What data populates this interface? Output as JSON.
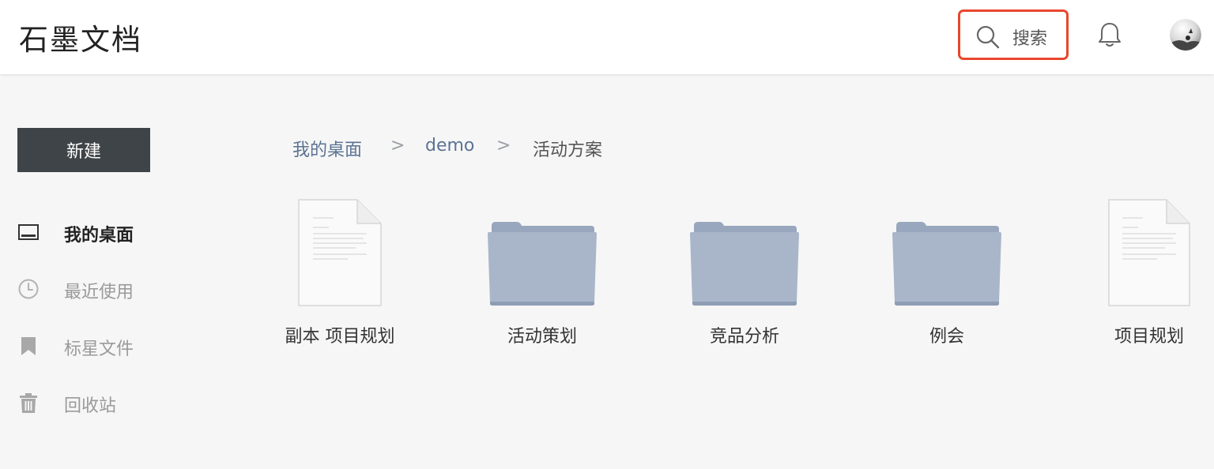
{
  "app": {
    "logo_text": "石墨文档"
  },
  "header": {
    "search_label": "搜索"
  },
  "sidebar": {
    "new_button": "新建",
    "items": [
      {
        "label": "我的桌面",
        "icon": "desktop-icon",
        "active": true
      },
      {
        "label": "最近使用",
        "icon": "clock-icon",
        "active": false
      },
      {
        "label": "标星文件",
        "icon": "bookmark-icon",
        "active": false
      },
      {
        "label": "回收站",
        "icon": "trash-icon",
        "active": false
      }
    ]
  },
  "breadcrumb": {
    "items": [
      "我的桌面",
      "demo",
      "活动方案"
    ],
    "separator": ">"
  },
  "files": [
    {
      "name": "副本 项目规划",
      "type": "document"
    },
    {
      "name": "活动策划",
      "type": "folder"
    },
    {
      "name": "竞品分析",
      "type": "folder"
    },
    {
      "name": "例会",
      "type": "folder"
    },
    {
      "name": "项目规划",
      "type": "document"
    }
  ],
  "colors": {
    "accent_highlight": "#e8472d",
    "new_button_bg": "#3f4448",
    "breadcrumb_link": "#5b7393",
    "folder": "#a9b6c9"
  }
}
